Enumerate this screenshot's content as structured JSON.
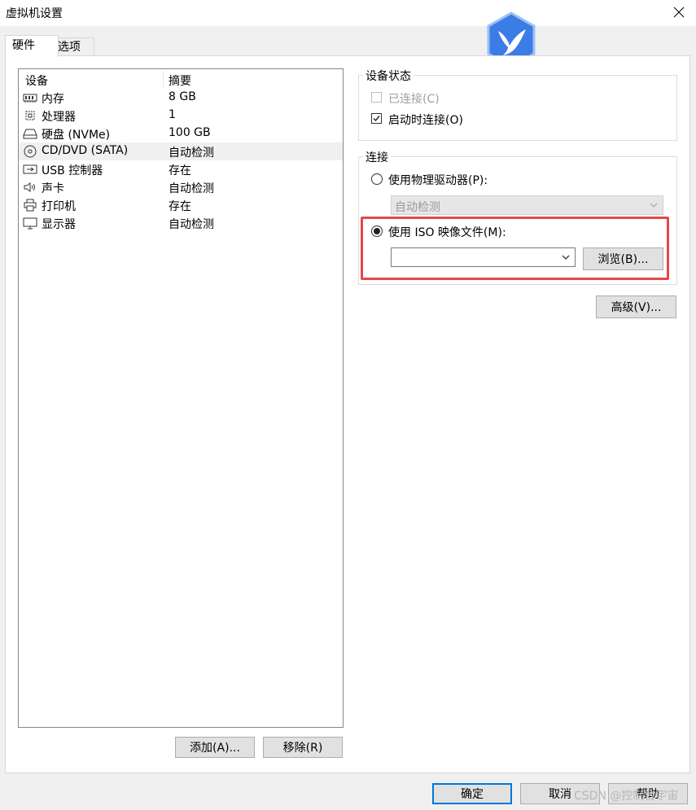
{
  "window": {
    "title": "虚拟机设置"
  },
  "tabs": [
    {
      "label": "硬件",
      "active": true
    },
    {
      "label": "选项",
      "active": false
    }
  ],
  "device_list": {
    "columns": [
      "设备",
      "摘要"
    ],
    "rows": [
      {
        "icon": "memory-icon",
        "name": "内存",
        "summary": "8 GB"
      },
      {
        "icon": "cpu-icon",
        "name": "处理器",
        "summary": "1"
      },
      {
        "icon": "disk-icon",
        "name": "硬盘 (NVMe)",
        "summary": "100 GB"
      },
      {
        "icon": "cd-icon",
        "name": "CD/DVD (SATA)",
        "summary": "自动检测",
        "selected": true
      },
      {
        "icon": "usb-icon",
        "name": "USB 控制器",
        "summary": "存在"
      },
      {
        "icon": "speaker-icon",
        "name": "声卡",
        "summary": "自动检测"
      },
      {
        "icon": "printer-icon",
        "name": "打印机",
        "summary": "存在"
      },
      {
        "icon": "monitor-icon",
        "name": "显示器",
        "summary": "自动检测"
      }
    ]
  },
  "buttons": {
    "add": "添加(A)...",
    "remove": "移除(R)",
    "ok": "确定",
    "cancel": "取消",
    "help": "帮助",
    "browse": "浏览(B)...",
    "advanced": "高级(V)..."
  },
  "device_status": {
    "title": "设备状态",
    "connected_label": "已连接(C)",
    "connected_checked": false,
    "connected_disabled": true,
    "connect_on_power_label": "启动时连接(O)",
    "connect_on_power_checked": true
  },
  "connection": {
    "title": "连接",
    "physical_label": "使用物理驱动器(P):",
    "physical_value": "自动检测",
    "iso_label": "使用 ISO 映像文件(M):",
    "iso_value": "",
    "selected": "iso"
  },
  "watermark": "CSDN @控制台宇宙",
  "colors": {
    "highlight": "#e8474a",
    "logo": "#3b7ce6",
    "primary_border": "#0078d7"
  }
}
